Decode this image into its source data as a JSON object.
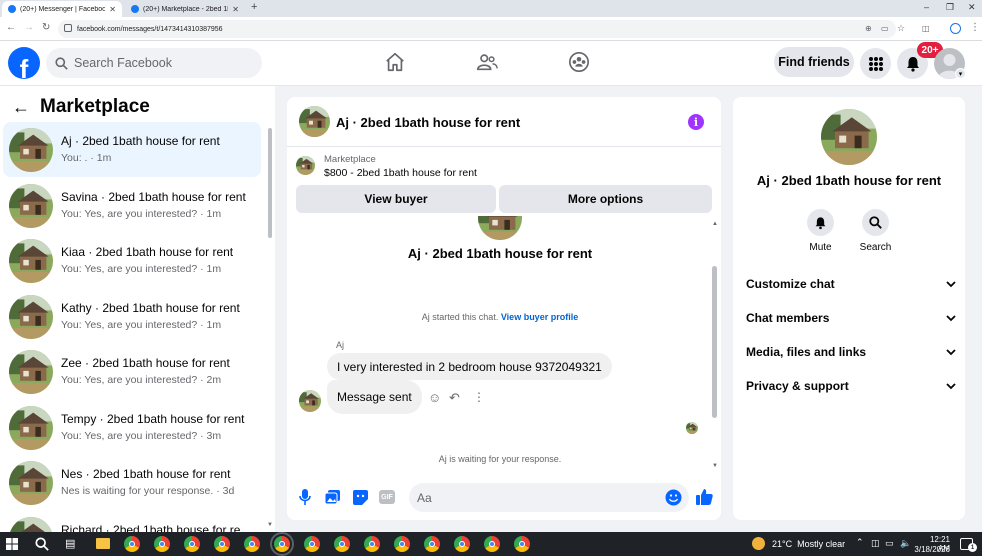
{
  "browser": {
    "tabs": [
      {
        "title": "(20+) Messenger | Facebook",
        "active": true
      },
      {
        "title": "(20+) Marketplace - 2bed 1bath",
        "active": false
      }
    ],
    "url": "facebook.com/messages/t/1473414310387956"
  },
  "topbar": {
    "search_placeholder": "Search Facebook",
    "find_friends": "Find friends",
    "notif_count": "20+",
    "brand_color": "#0866ff",
    "icons": [
      "home-icon",
      "friends-icon",
      "groups-icon",
      "menu-grid-icon",
      "bell-icon",
      "profile-icon"
    ]
  },
  "sidebar": {
    "title": "Marketplace",
    "conversations": [
      {
        "name": "Aj · 2bed 1bath house for rent",
        "preview": "You: . · 1m",
        "selected": true
      },
      {
        "name": "Savina · 2bed 1bath house for rent",
        "preview": "You: Yes, are you interested? · 1m"
      },
      {
        "name": "Kiaa · 2bed 1bath house for rent",
        "preview": "You: Yes, are you interested? · 1m"
      },
      {
        "name": "Kathy · 2bed 1bath house for rent",
        "preview": "You: Yes, are you interested? · 1m"
      },
      {
        "name": "Zee · 2bed 1bath house for rent",
        "preview": "You: Yes, are you interested? · 2m"
      },
      {
        "name": "Tempy · 2bed 1bath house for rent",
        "preview": "You: Yes, are you interested? · 3m"
      },
      {
        "name": "Nes · 2bed 1bath house for rent",
        "preview": "Nes is waiting for your response. · 3d"
      },
      {
        "name": "Richard · 2bed 1bath house for re",
        "preview": ""
      }
    ]
  },
  "chat": {
    "title": "Aj · 2bed 1bath house for rent",
    "marketplace_label": "Marketplace",
    "listing": "$800 - 2bed 1bath house for rent",
    "view_buyer": "View buyer",
    "more_options": "More options",
    "thread_title": "Aj · 2bed 1bath house for rent",
    "started_text": "Aj started this chat.",
    "view_profile": "View buyer profile",
    "sender": "Aj",
    "incoming_message": "I very interested in 2 bedroom house 9372049321",
    "outgoing_message": "Message sent",
    "waiting_text": "Aj is waiting for your response.",
    "composer_placeholder": "Aa",
    "accent_color": "#0866ff"
  },
  "rightpanel": {
    "name": "Aj · 2bed 1bath house for rent",
    "mute": "Mute",
    "search": "Search",
    "sections": [
      "Customize chat",
      "Chat members",
      "Media, files and links",
      "Privacy & support"
    ]
  },
  "taskbar": {
    "weather": "21°C  Mostly clear",
    "time": "12:21 AM",
    "date": "3/18/2026",
    "notif": "1"
  }
}
